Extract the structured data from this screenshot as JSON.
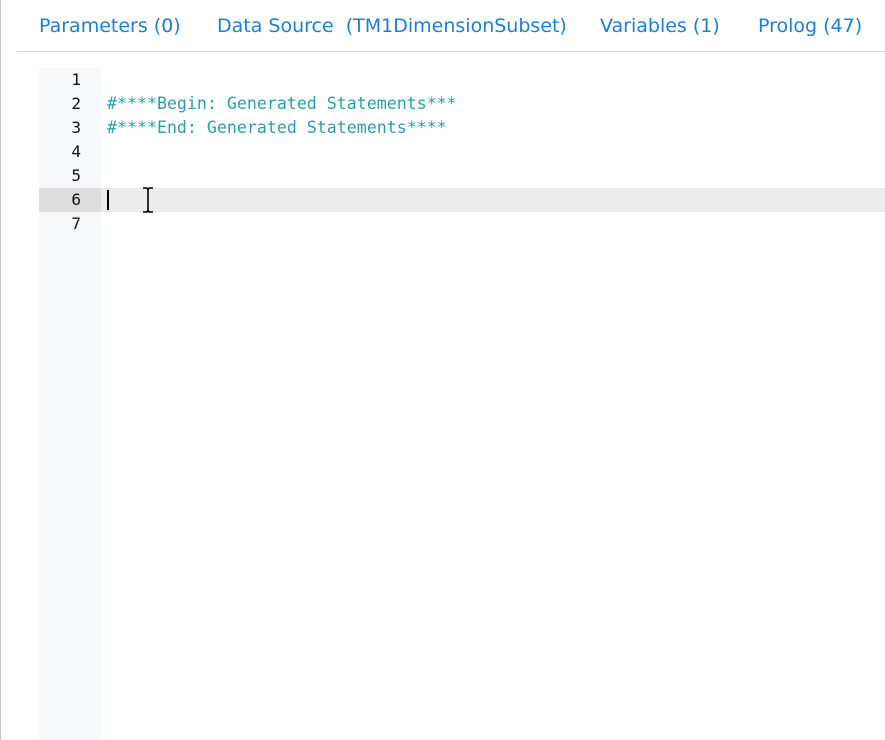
{
  "tabs": [
    {
      "label": "Parameters (0)"
    },
    {
      "label": "Data Source  (TM1DimensionSubset)"
    },
    {
      "label": "Variables (1)"
    },
    {
      "label": "Prolog (47)"
    }
  ],
  "editor": {
    "lines": [
      {
        "number": "1",
        "text": ""
      },
      {
        "number": "2",
        "text": "#****Begin: Generated Statements***"
      },
      {
        "number": "3",
        "text": "#****End: Generated Statements****"
      },
      {
        "number": "4",
        "text": ""
      },
      {
        "number": "5",
        "text": ""
      },
      {
        "number": "6",
        "text": ""
      },
      {
        "number": "7",
        "text": ""
      }
    ],
    "active_line": "6",
    "comment_color": "#2a9fab",
    "tab_color": "#1a7fd9"
  },
  "cursor": {
    "icon": "text-cursor-ibeam-icon"
  }
}
